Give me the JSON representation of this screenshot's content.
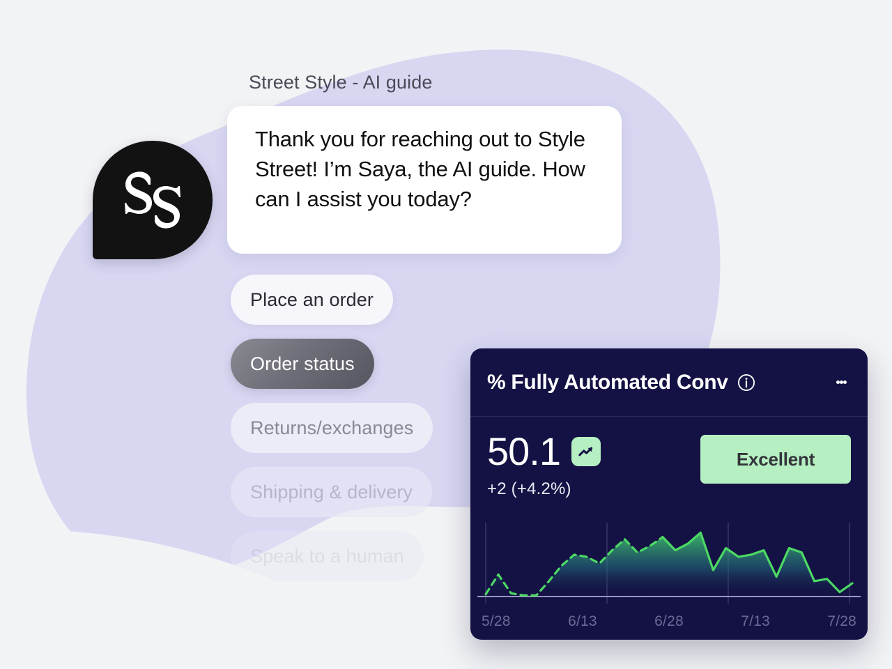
{
  "page": {
    "background_color": "#f2f3f5",
    "blob_color": "#d8d7f2"
  },
  "chat": {
    "title": "Street Style - AI guide",
    "avatar": {
      "icon": "style-street-monogram-icon",
      "background_color": "#121212"
    },
    "message": "Thank you for reaching out to Style Street! I’m Saya, the AI guide. How can I assist you today?",
    "quick_replies": [
      {
        "label": "Place an order",
        "state": "default"
      },
      {
        "label": "Order status",
        "state": "selected"
      },
      {
        "label": "Returns/exchanges",
        "state": "default"
      },
      {
        "label": "Shipping & delivery",
        "state": "default"
      },
      {
        "label": "Speak to a human",
        "state": "default"
      }
    ]
  },
  "metric_card": {
    "title": "% Fully Automated Conv",
    "info_icon": "info-circle-icon",
    "menu_icon": "kebab-menu-icon",
    "value": "50.1",
    "trend_icon": "trending-up-icon",
    "delta": "+2 (+4.2%)",
    "rating": "Excellent",
    "accent_color": "#b6f0c2",
    "card_color": "#141244",
    "line_color": "#4cd964"
  },
  "chart_data": {
    "type": "area",
    "title": "% Fully Automated Conv",
    "xlabel": "",
    "ylabel": "",
    "grid": true,
    "legend": "none",
    "x_tick_labels": [
      "5/28",
      "6/13",
      "6/28",
      "7/13",
      "7/28"
    ],
    "ylim": [
      0,
      62
    ],
    "series": [
      {
        "name": "% Fully Automated Conv",
        "style_forecast_dashed_until_index": 14,
        "values": [
          2,
          20,
          3,
          1,
          1,
          14,
          28,
          38,
          36,
          30,
          42,
          52,
          40,
          46,
          54,
          42,
          48,
          58,
          24,
          44,
          36,
          38,
          42,
          18,
          44,
          40,
          14,
          16,
          4,
          12
        ]
      }
    ]
  }
}
